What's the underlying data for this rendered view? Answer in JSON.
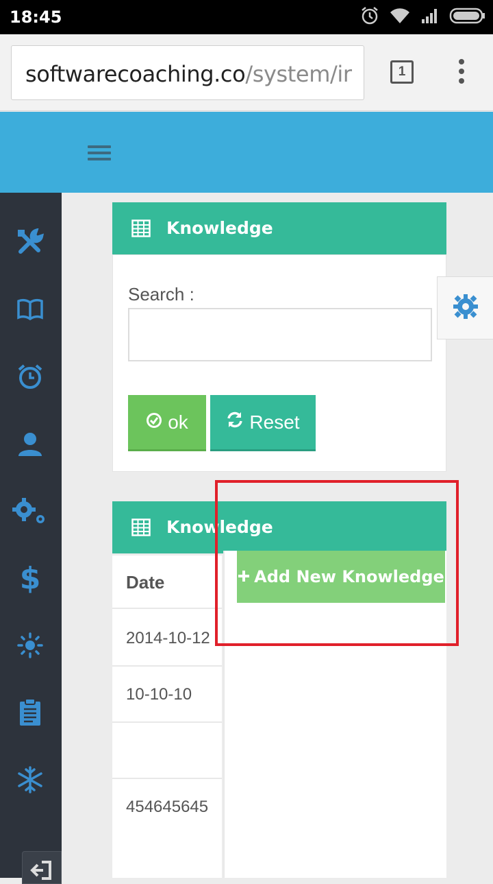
{
  "status_bar": {
    "time": "18:45",
    "icons": [
      "alarm-icon",
      "wifi-icon",
      "signal-icon",
      "battery-icon"
    ]
  },
  "browser": {
    "url_domain": "softwarecoaching.co",
    "url_path": "/system/ir",
    "tab_count": "1",
    "menu_icon": "overflow-menu-icon"
  },
  "header": {
    "menu_icon": "hamburger-icon",
    "background_color": "#3daddb"
  },
  "sidebar": {
    "items": [
      {
        "icon": "tools-icon"
      },
      {
        "icon": "book-icon"
      },
      {
        "icon": "alarm-clock-icon"
      },
      {
        "icon": "user-icon"
      },
      {
        "icon": "gears-icon"
      },
      {
        "icon": "dollar-icon"
      },
      {
        "icon": "sun-icon"
      },
      {
        "icon": "clipboard-icon"
      },
      {
        "icon": "snowflake-icon"
      }
    ],
    "logout_icon": "sign-out-icon"
  },
  "search_panel": {
    "title": "Knowledge",
    "search_label": "Search :",
    "search_value": "",
    "ok_label": "ok",
    "reset_label": "Reset"
  },
  "list_panel": {
    "title": "Knowledge",
    "add_button_label": "Add New Knowledge",
    "table": {
      "header": "Date",
      "rows": [
        "2014-10-12",
        "10-10-10",
        "",
        "454645645"
      ]
    }
  },
  "colors": {
    "panel_header": "#35ba99",
    "ok_button": "#6cc45c",
    "add_button": "#83d07a",
    "sidebar_bg": "#2d333c",
    "sidebar_icon": "#3a8fd0",
    "highlight": "#e0202a"
  }
}
